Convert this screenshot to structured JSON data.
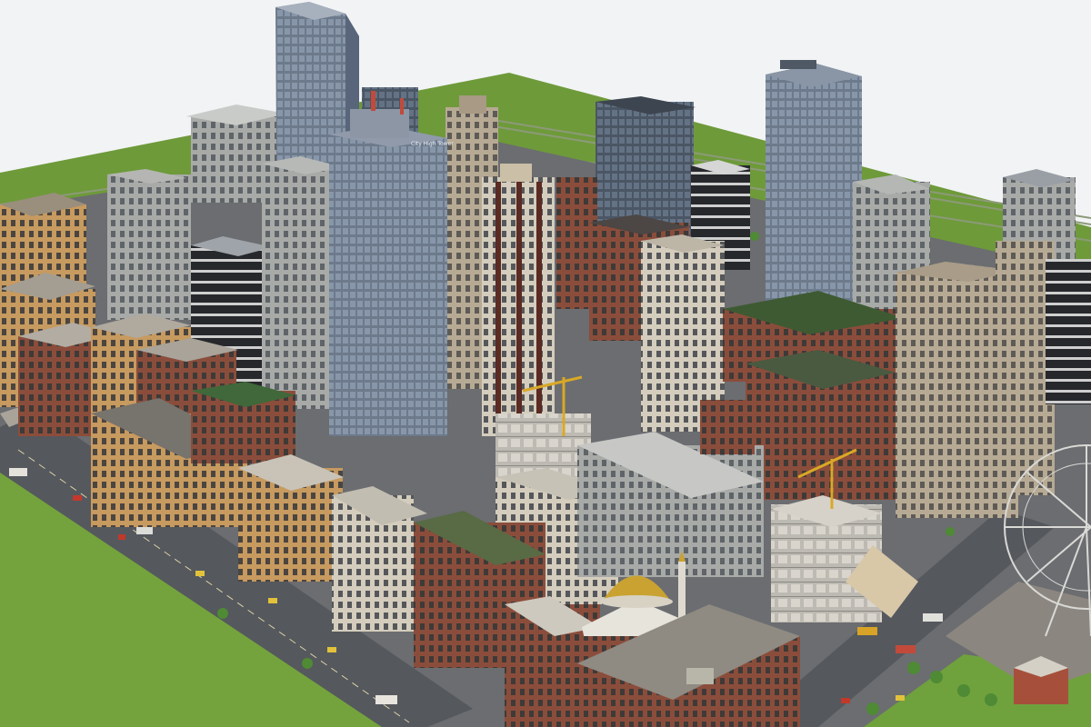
{
  "scene": {
    "tower_sign": "City High Tower",
    "colors": {
      "sky": "#f2f3f5",
      "grass": "#6e9a3a",
      "grass_light": "#7aa842",
      "road": "#55585d",
      "sidewalk": "#a9a39a",
      "glass": "#6f7d8f",
      "glass_dark": "#4d5866",
      "brick": "#8d4e3c",
      "stone": "#b9aa93",
      "dome": "#c9a232"
    }
  }
}
